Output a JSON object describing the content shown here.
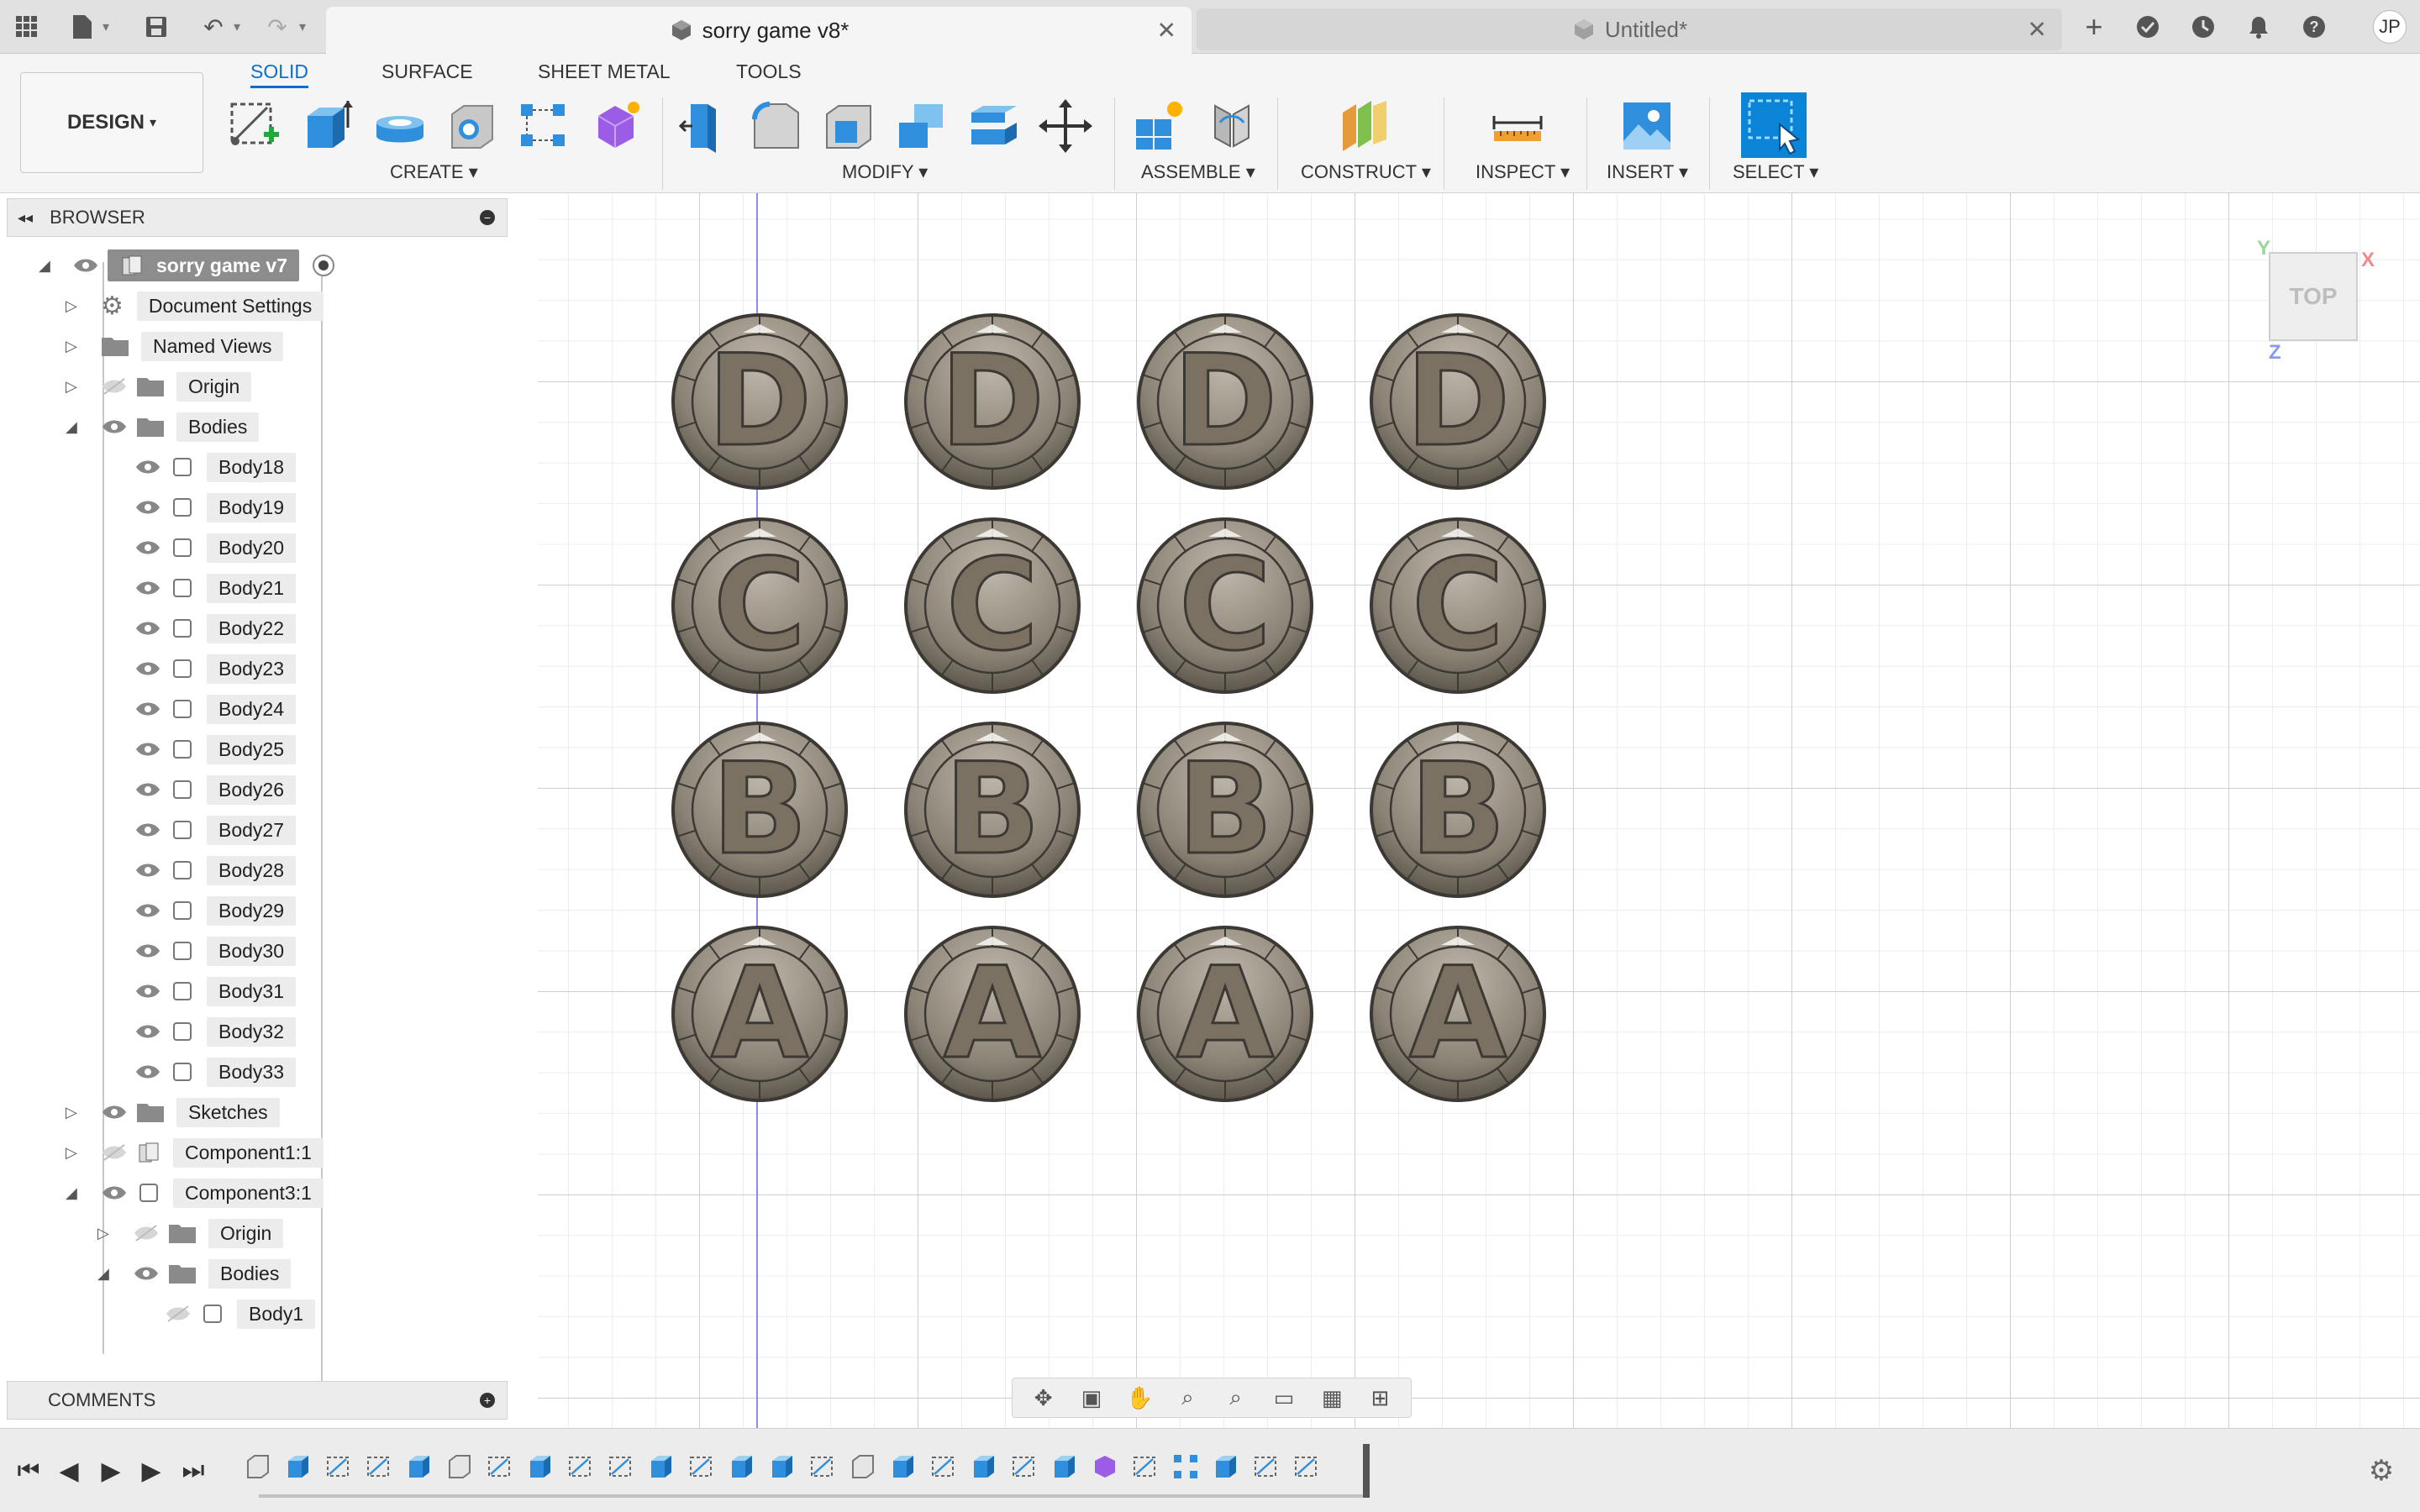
{
  "tabs": {
    "active_title": "sorry game v8*",
    "inactive_title": "Untitled*"
  },
  "user": {
    "initials": "JP"
  },
  "toolbar": {
    "workspace": "DESIGN",
    "modes": [
      "SOLID",
      "SURFACE",
      "SHEET METAL",
      "TOOLS"
    ],
    "active_mode": "SOLID",
    "groups": {
      "create": "CREATE",
      "modify": "MODIFY",
      "assemble": "ASSEMBLE",
      "construct": "CONSTRUCT",
      "inspect": "INSPECT",
      "insert": "INSERT",
      "select": "SELECT"
    }
  },
  "browser": {
    "title": "BROWSER",
    "root": "sorry game v7",
    "doc_settings": "Document Settings",
    "named_views": "Named Views",
    "origin": "Origin",
    "bodies": "Bodies",
    "body_items": [
      "Body18",
      "Body19",
      "Body20",
      "Body21",
      "Body22",
      "Body23",
      "Body24",
      "Body25",
      "Body26",
      "Body27",
      "Body28",
      "Body29",
      "Body30",
      "Body31",
      "Body32",
      "Body33"
    ],
    "sketches": "Sketches",
    "component1": "Component1:1",
    "component3": "Component3:1",
    "comp3_origin": "Origin",
    "comp3_bodies": "Bodies",
    "comp3_body": "Body1"
  },
  "comments": {
    "title": "COMMENTS"
  },
  "canvas": {
    "token_rows": [
      "D",
      "C",
      "B",
      "A"
    ],
    "tokens_per_row": 4,
    "viewcube_face": "TOP",
    "axis_labels": {
      "x": "X",
      "y": "Y",
      "z": "Z"
    },
    "colors": {
      "token_fill": "#8a8275",
      "token_edge": "#3c3833",
      "y_axis": "#8a8cf0"
    }
  }
}
